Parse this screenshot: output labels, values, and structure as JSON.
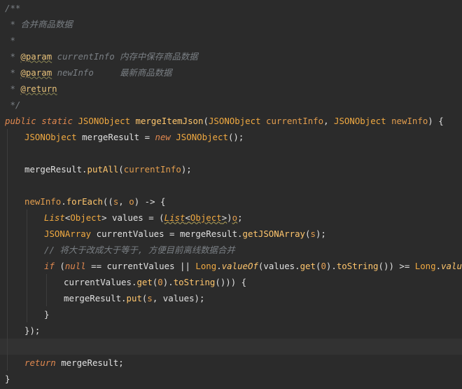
{
  "editor": {
    "colors": {
      "background": "#2b2b2b",
      "current_line": "#323232",
      "comment": "#7a7f84",
      "keyword": "#e0884f",
      "type": "#f0a941",
      "method": "#ffc66d",
      "default": "#e0e0e0"
    },
    "lines": [
      {
        "tokens": [
          {
            "t": "/**",
            "c": "cm"
          }
        ]
      },
      {
        "tokens": [
          {
            "t": " * 合并商品数据",
            "c": "cm"
          }
        ]
      },
      {
        "tokens": [
          {
            "t": " *",
            "c": "cm"
          }
        ]
      },
      {
        "tokens": [
          {
            "t": " * ",
            "c": "cm"
          },
          {
            "t": "@param",
            "c": "tg"
          },
          {
            "t": " currentInfo 内存中保存商品数据",
            "c": "cm"
          }
        ]
      },
      {
        "tokens": [
          {
            "t": " * ",
            "c": "cm"
          },
          {
            "t": "@param",
            "c": "tg"
          },
          {
            "t": " newInfo     最新商品数据",
            "c": "cm"
          }
        ]
      },
      {
        "tokens": [
          {
            "t": " * ",
            "c": "cm"
          },
          {
            "t": "@return",
            "c": "tg"
          }
        ]
      },
      {
        "tokens": [
          {
            "t": " */",
            "c": "cm"
          }
        ]
      },
      {
        "tokens": [
          {
            "t": "public ",
            "c": "kw"
          },
          {
            "t": "static ",
            "c": "kw"
          },
          {
            "t": "JSONObject ",
            "c": "tp"
          },
          {
            "t": "mergeItemJson",
            "c": "fn"
          },
          {
            "t": "(",
            "c": "df"
          },
          {
            "t": "JSONObject ",
            "c": "tp"
          },
          {
            "t": "currentInfo",
            "c": "pa"
          },
          {
            "t": ", ",
            "c": "df"
          },
          {
            "t": "JSONObject ",
            "c": "tp"
          },
          {
            "t": "newInfo",
            "c": "pa"
          },
          {
            "t": ") {",
            "c": "df"
          }
        ]
      },
      {
        "indent": 1,
        "tokens": [
          {
            "t": "JSONObject ",
            "c": "tp"
          },
          {
            "t": "mergeResult = ",
            "c": "df"
          },
          {
            "t": "new ",
            "c": "kw"
          },
          {
            "t": "JSONObject",
            "c": "tp"
          },
          {
            "t": "();",
            "c": "df"
          }
        ]
      },
      {
        "indent": 1,
        "tokens": []
      },
      {
        "indent": 1,
        "tokens": [
          {
            "t": "mergeResult.",
            "c": "df"
          },
          {
            "t": "putAll",
            "c": "fn"
          },
          {
            "t": "(",
            "c": "df"
          },
          {
            "t": "currentInfo",
            "c": "pa"
          },
          {
            "t": ");",
            "c": "df"
          }
        ]
      },
      {
        "indent": 1,
        "tokens": []
      },
      {
        "indent": 1,
        "tokens": [
          {
            "t": "newInfo",
            "c": "pa"
          },
          {
            "t": ".",
            "c": "df"
          },
          {
            "t": "forEach",
            "c": "fn"
          },
          {
            "t": "((",
            "c": "df"
          },
          {
            "t": "s",
            "c": "pa"
          },
          {
            "t": ", ",
            "c": "df"
          },
          {
            "t": "o",
            "c": "pa"
          },
          {
            "t": ") -> {",
            "c": "df"
          }
        ]
      },
      {
        "indent": 2,
        "tokens": [
          {
            "t": "List",
            "c": "tp",
            "it": true
          },
          {
            "t": "<",
            "c": "df"
          },
          {
            "t": "Object",
            "c": "tp"
          },
          {
            "t": "> values = ",
            "c": "df"
          },
          {
            "t": "(",
            "c": "df"
          },
          {
            "t": "List",
            "c": "tp",
            "it": true,
            "u": true
          },
          {
            "t": "<",
            "c": "df",
            "u": true
          },
          {
            "t": "Object",
            "c": "tp",
            "u": true
          },
          {
            "t": ">",
            "c": "df",
            "u": true
          },
          {
            "t": ")",
            "c": "df"
          },
          {
            "t": "o",
            "c": "pa",
            "u": true
          },
          {
            "t": ";",
            "c": "df"
          }
        ]
      },
      {
        "indent": 2,
        "tokens": [
          {
            "t": "JSONArray ",
            "c": "tp"
          },
          {
            "t": "currentValues = mergeResult.",
            "c": "df"
          },
          {
            "t": "getJSONArray",
            "c": "fn"
          },
          {
            "t": "(",
            "c": "df"
          },
          {
            "t": "s",
            "c": "pa"
          },
          {
            "t": ");",
            "c": "df"
          }
        ]
      },
      {
        "indent": 2,
        "tokens": [
          {
            "t": "// 将大于改成大于等于, 方便目前离线数据合并",
            "c": "cm"
          }
        ]
      },
      {
        "indent": 2,
        "tokens": [
          {
            "t": "if ",
            "c": "kw"
          },
          {
            "t": "(",
            "c": "df"
          },
          {
            "t": "null ",
            "c": "kw"
          },
          {
            "t": "== currentValues || ",
            "c": "df"
          },
          {
            "t": "Long",
            "c": "tp"
          },
          {
            "t": ".",
            "c": "df"
          },
          {
            "t": "valueOf",
            "c": "fn",
            "it": true
          },
          {
            "t": "(values.",
            "c": "df"
          },
          {
            "t": "get",
            "c": "fn"
          },
          {
            "t": "(",
            "c": "df"
          },
          {
            "t": "0",
            "c": "nm"
          },
          {
            "t": ").",
            "c": "df"
          },
          {
            "t": "toString",
            "c": "fn"
          },
          {
            "t": "()) >= ",
            "c": "df"
          },
          {
            "t": "Long",
            "c": "tp"
          },
          {
            "t": ".",
            "c": "df"
          },
          {
            "t": "valueOf",
            "c": "fn",
            "it": true
          },
          {
            "t": "(",
            "c": "df"
          }
        ]
      },
      {
        "indent": 3,
        "tokens": [
          {
            "t": "currentValues.",
            "c": "df"
          },
          {
            "t": "get",
            "c": "fn"
          },
          {
            "t": "(",
            "c": "df"
          },
          {
            "t": "0",
            "c": "nm"
          },
          {
            "t": ").",
            "c": "df"
          },
          {
            "t": "toString",
            "c": "fn"
          },
          {
            "t": "())) {",
            "c": "df"
          }
        ]
      },
      {
        "indent": 3,
        "tokens": [
          {
            "t": "mergeResult.",
            "c": "df"
          },
          {
            "t": "put",
            "c": "fn"
          },
          {
            "t": "(",
            "c": "df"
          },
          {
            "t": "s",
            "c": "pa"
          },
          {
            "t": ", values);",
            "c": "df"
          }
        ]
      },
      {
        "indent": 2,
        "tokens": [
          {
            "t": "}",
            "c": "df"
          }
        ]
      },
      {
        "indent": 1,
        "tokens": [
          {
            "t": "});",
            "c": "df"
          }
        ]
      },
      {
        "indent": 1,
        "tokens": [],
        "current": true
      },
      {
        "indent": 1,
        "tokens": [
          {
            "t": "return ",
            "c": "kw"
          },
          {
            "t": "mergeResult;",
            "c": "df"
          }
        ]
      },
      {
        "tokens": [
          {
            "t": "}",
            "c": "df"
          }
        ]
      }
    ]
  }
}
